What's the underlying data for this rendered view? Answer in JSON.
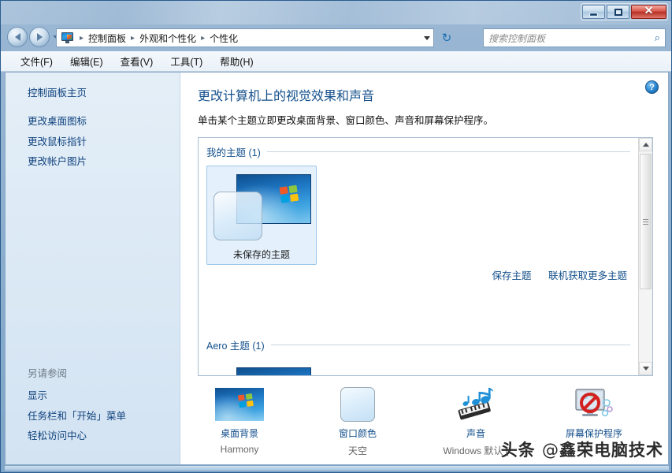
{
  "window": {
    "caption_buttons": {
      "minimize": "minimize-button",
      "maximize": "maximize-button",
      "close_label": "✕"
    }
  },
  "addressbar": {
    "breadcrumb": [
      {
        "label": "控制面板"
      },
      {
        "label": "外观和个性化"
      },
      {
        "label": "个性化"
      }
    ],
    "separator": "▸",
    "refresh_glyph": "↻",
    "search": {
      "placeholder": "搜索控制面板",
      "value": "",
      "icon_glyph": "⌕"
    }
  },
  "menubar": {
    "items": [
      {
        "label": "文件(F)"
      },
      {
        "label": "编辑(E)"
      },
      {
        "label": "查看(V)"
      },
      {
        "label": "工具(T)"
      },
      {
        "label": "帮助(H)"
      }
    ]
  },
  "sidebar": {
    "home": "控制面板主页",
    "links": [
      {
        "label": "更改桌面图标"
      },
      {
        "label": "更改鼠标指针"
      },
      {
        "label": "更改帐户图片"
      }
    ],
    "see_also_heading": "另请参阅",
    "see_also": [
      {
        "label": "显示"
      },
      {
        "label": "任务栏和「开始」菜单"
      },
      {
        "label": "轻松访问中心"
      }
    ]
  },
  "content": {
    "help_glyph": "?",
    "title": "更改计算机上的视觉效果和声音",
    "subtitle": "单击某个主题立即更改桌面背景、窗口颜色、声音和屏幕保护程序。",
    "groups": [
      {
        "heading": "我的主题 (1)",
        "themes": [
          {
            "label": "未保存的主题",
            "selected": true
          }
        ]
      },
      {
        "heading": "Aero 主题 (1)",
        "themes": [
          {
            "label": "",
            "selected": false
          }
        ]
      }
    ],
    "actions": [
      {
        "label": "保存主题"
      },
      {
        "label": "联机获取更多主题"
      }
    ]
  },
  "bottom_toolbar": {
    "items": [
      {
        "name": "桌面背景",
        "value": "Harmony",
        "icon": "wallpaper-icon"
      },
      {
        "name": "窗口颜色",
        "value": "天空",
        "icon": "window-color-icon"
      },
      {
        "name": "声音",
        "value": "Windows 默认 (",
        "icon": "sound-icon"
      },
      {
        "name": "屏幕保护程序",
        "value": "",
        "icon": "screensaver-icon"
      }
    ],
    "annotation": "red-circle-highlight"
  },
  "watermark": {
    "prefix": "头条 ",
    "at": "@",
    "handle": "鑫荣电脑技术"
  },
  "colors": {
    "accent_link": "#14508c",
    "title_text": "#14508c",
    "close_button": "#b72f25",
    "annotation_red": "#ee1111"
  }
}
